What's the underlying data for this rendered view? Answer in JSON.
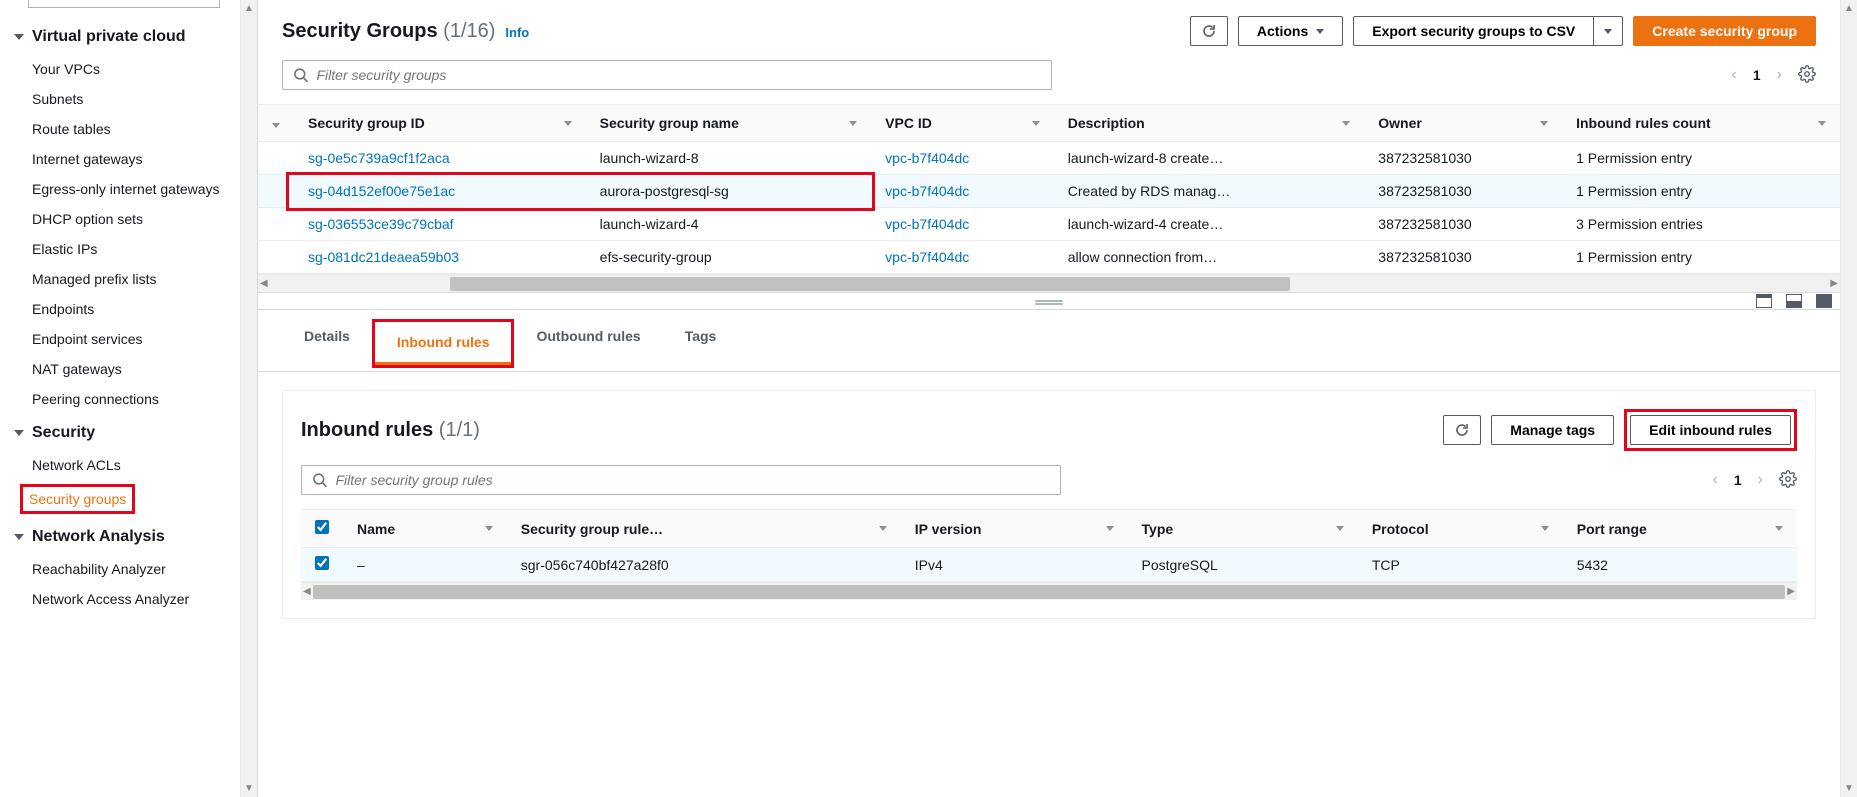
{
  "sidebar": {
    "sections": [
      {
        "label": "Virtual private cloud",
        "items": [
          "Your VPCs",
          "Subnets",
          "Route tables",
          "Internet gateways",
          "Egress-only internet gateways",
          "DHCP option sets",
          "Elastic IPs",
          "Managed prefix lists",
          "Endpoints",
          "Endpoint services",
          "NAT gateways",
          "Peering connections"
        ]
      },
      {
        "label": "Security",
        "items": [
          "Network ACLs",
          "Security groups"
        ]
      },
      {
        "label": "Network Analysis",
        "items": [
          "Reachability Analyzer",
          "Network Access Analyzer"
        ]
      }
    ],
    "activeItem": "Security groups"
  },
  "header": {
    "title": "Security Groups",
    "countText": "(1/16)",
    "infoLabel": "Info",
    "actionsLabel": "Actions",
    "exportLabel": "Export security groups to CSV",
    "createLabel": "Create security group"
  },
  "filter": {
    "placeholder": "Filter security groups",
    "page": "1"
  },
  "tableHeaders": [
    "Security group ID",
    "Security group name",
    "VPC ID",
    "Description",
    "Owner",
    "Inbound rules count"
  ],
  "rows": [
    {
      "sgid": "sg-0e5c739a9cf1f2aca",
      "name": "launch-wizard-8",
      "vpc": "vpc-b7f404dc",
      "desc": "launch-wizard-8 create…",
      "owner": "387232581030",
      "inbound": "1 Permission entry"
    },
    {
      "sgid": "sg-04d152ef00e75e1ac",
      "name": "aurora-postgresql-sg",
      "vpc": "vpc-b7f404dc",
      "desc": "Created by RDS manag…",
      "owner": "387232581030",
      "inbound": "1 Permission entry",
      "selected": true,
      "highlight": true
    },
    {
      "sgid": "sg-036553ce39c79cbaf",
      "name": "launch-wizard-4",
      "vpc": "vpc-b7f404dc",
      "desc": "launch-wizard-4 create…",
      "owner": "387232581030",
      "inbound": "3 Permission entries"
    },
    {
      "sgid": "sg-081dc21deaea59b03",
      "name": "efs-security-group",
      "vpc": "vpc-b7f404dc",
      "desc": "allow connection from…",
      "owner": "387232581030",
      "inbound": "1 Permission entry"
    }
  ],
  "detail": {
    "tabs": [
      "Details",
      "Inbound rules",
      "Outbound rules",
      "Tags"
    ],
    "activeTab": "Inbound rules",
    "panelTitle": "Inbound rules",
    "panelCount": "(1/1)",
    "manageTagsLabel": "Manage tags",
    "editInboundLabel": "Edit inbound rules",
    "filterPlaceholder": "Filter security group rules",
    "page": "1",
    "ruleHeaders": [
      "Name",
      "Security group rule…",
      "IP version",
      "Type",
      "Protocol",
      "Port range"
    ],
    "rules": [
      {
        "name": "–",
        "sgrid": "sgr-056c740bf427a28f0",
        "ipv": "IPv4",
        "type": "PostgreSQL",
        "protocol": "TCP",
        "port": "5432",
        "checked": true
      }
    ]
  }
}
